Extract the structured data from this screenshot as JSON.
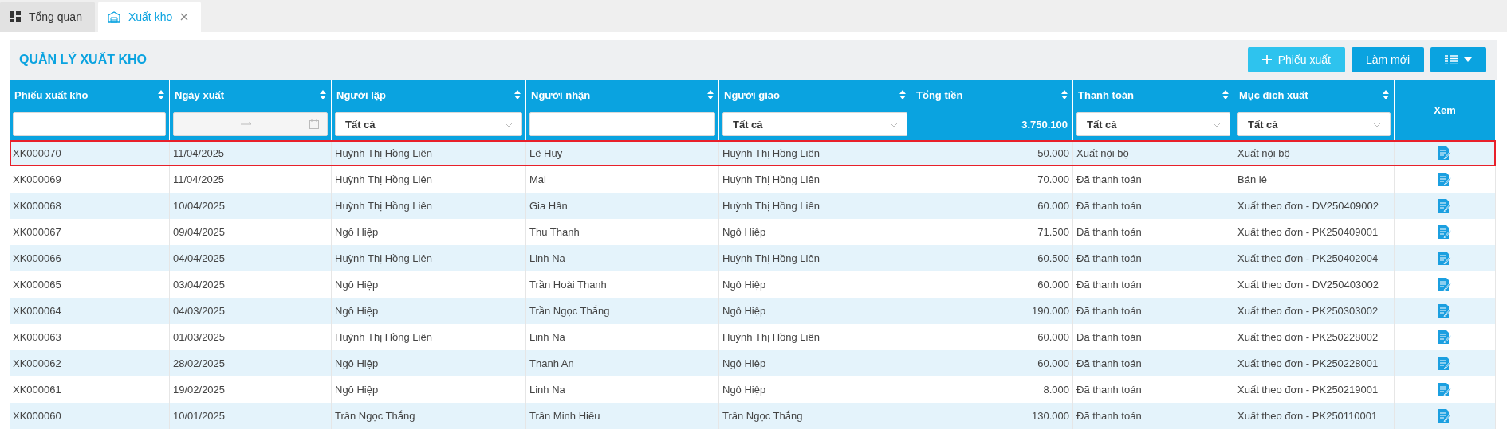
{
  "tabs": [
    {
      "label": "Tổng quan",
      "kind": "dashboard",
      "selected": false,
      "closable": false
    },
    {
      "label": "Xuất kho",
      "kind": "warehouse",
      "selected": true,
      "closable": true
    }
  ],
  "page_title": "QUẢN LÝ XUẤT KHO",
  "toolbar": [
    {
      "kind": "add",
      "label": "Phiếu xuất"
    },
    {
      "kind": "plain",
      "label": "Làm mới"
    },
    {
      "kind": "columns"
    }
  ],
  "table": {
    "columns": [
      {
        "label": "Phiếu xuất kho",
        "kind": "text",
        "sortable": true,
        "filter": {
          "kind": "text"
        }
      },
      {
        "label": "Ngày xuất",
        "kind": "text",
        "sortable": true,
        "filter": {
          "kind": "daterange"
        }
      },
      {
        "label": "Người lập",
        "kind": "text",
        "sortable": true,
        "filter": {
          "kind": "select",
          "value": "Tất cả"
        }
      },
      {
        "label": "Người nhận",
        "kind": "text",
        "sortable": true,
        "filter": {
          "kind": "text"
        }
      },
      {
        "label": "Người giao",
        "kind": "text",
        "sortable": true,
        "filter": {
          "kind": "select",
          "value": "Tất cả"
        }
      },
      {
        "label": "Tổng tiền",
        "kind": "number",
        "sortable": true,
        "filter": {
          "kind": "total",
          "value": "3.750.100"
        }
      },
      {
        "label": "Thanh toán",
        "kind": "text",
        "sortable": true,
        "filter": {
          "kind": "select",
          "value": "Tất cả"
        }
      },
      {
        "label": "Mục đích xuất",
        "kind": "text",
        "sortable": true,
        "filter": {
          "kind": "select",
          "value": "Tất cả"
        }
      },
      {
        "label": "Xem",
        "kind": "action",
        "sortable": false
      }
    ],
    "rows": [
      {
        "selected": true,
        "cells": [
          "XK000070",
          "11/04/2025",
          "Huỳnh Thị Hồng Liên",
          "Lê Huy",
          "Huỳnh Thị Hồng Liên",
          "50.000",
          "Xuất nội bộ",
          "Xuất nội bộ"
        ]
      },
      {
        "selected": false,
        "cells": [
          "XK000069",
          "11/04/2025",
          "Huỳnh Thị Hồng Liên",
          "Mai",
          "Huỳnh Thị Hồng Liên",
          "70.000",
          "Đã thanh toán",
          "Bán lẻ"
        ]
      },
      {
        "selected": false,
        "cells": [
          "XK000068",
          "10/04/2025",
          "Huỳnh Thị Hồng Liên",
          "Gia Hân",
          "Huỳnh Thị Hồng Liên",
          "60.000",
          "Đã thanh toán",
          "Xuất theo đơn - DV250409002"
        ]
      },
      {
        "selected": false,
        "cells": [
          "XK000067",
          "09/04/2025",
          "Ngô Hiệp",
          "Thu Thanh",
          "Ngô Hiệp",
          "71.500",
          "Đã thanh toán",
          "Xuất theo đơn - PK250409001"
        ]
      },
      {
        "selected": false,
        "cells": [
          "XK000066",
          "04/04/2025",
          "Huỳnh Thị Hồng Liên",
          "Linh Na",
          "Huỳnh Thị Hồng Liên",
          "60.500",
          "Đã thanh toán",
          "Xuất theo đơn - PK250402004"
        ]
      },
      {
        "selected": false,
        "cells": [
          "XK000065",
          "03/04/2025",
          "Ngô Hiệp",
          "Trần Hoài Thanh",
          "Ngô Hiệp",
          "60.000",
          "Đã thanh toán",
          "Xuất theo đơn - DV250403002"
        ]
      },
      {
        "selected": false,
        "cells": [
          "XK000064",
          "04/03/2025",
          "Ngô Hiệp",
          "Trần Ngọc Thắng",
          "Ngô Hiệp",
          "190.000",
          "Đã thanh toán",
          "Xuất theo đơn - PK250303002"
        ]
      },
      {
        "selected": false,
        "cells": [
          "XK000063",
          "01/03/2025",
          "Huỳnh Thị Hồng Liên",
          "Linh Na",
          "Huỳnh Thị Hồng Liên",
          "60.000",
          "Đã thanh toán",
          "Xuất theo đơn - PK250228002"
        ]
      },
      {
        "selected": false,
        "cells": [
          "XK000062",
          "28/02/2025",
          "Ngô Hiệp",
          "Thanh An",
          "Ngô Hiệp",
          "60.000",
          "Đã thanh toán",
          "Xuất theo đơn - PK250228001"
        ]
      },
      {
        "selected": false,
        "cells": [
          "XK000061",
          "19/02/2025",
          "Ngô Hiệp",
          "Linh Na",
          "Ngô Hiệp",
          "8.000",
          "Đã thanh toán",
          "Xuất theo đơn - PK250219001"
        ]
      },
      {
        "selected": false,
        "cells": [
          "XK000060",
          "10/01/2025",
          "Trần Ngọc Thắng",
          "Trần Minh Hiếu",
          "Trần Ngọc Thắng",
          "130.000",
          "Đã thanh toán",
          "Xuất theo đơn - PK250110001"
        ]
      }
    ]
  }
}
